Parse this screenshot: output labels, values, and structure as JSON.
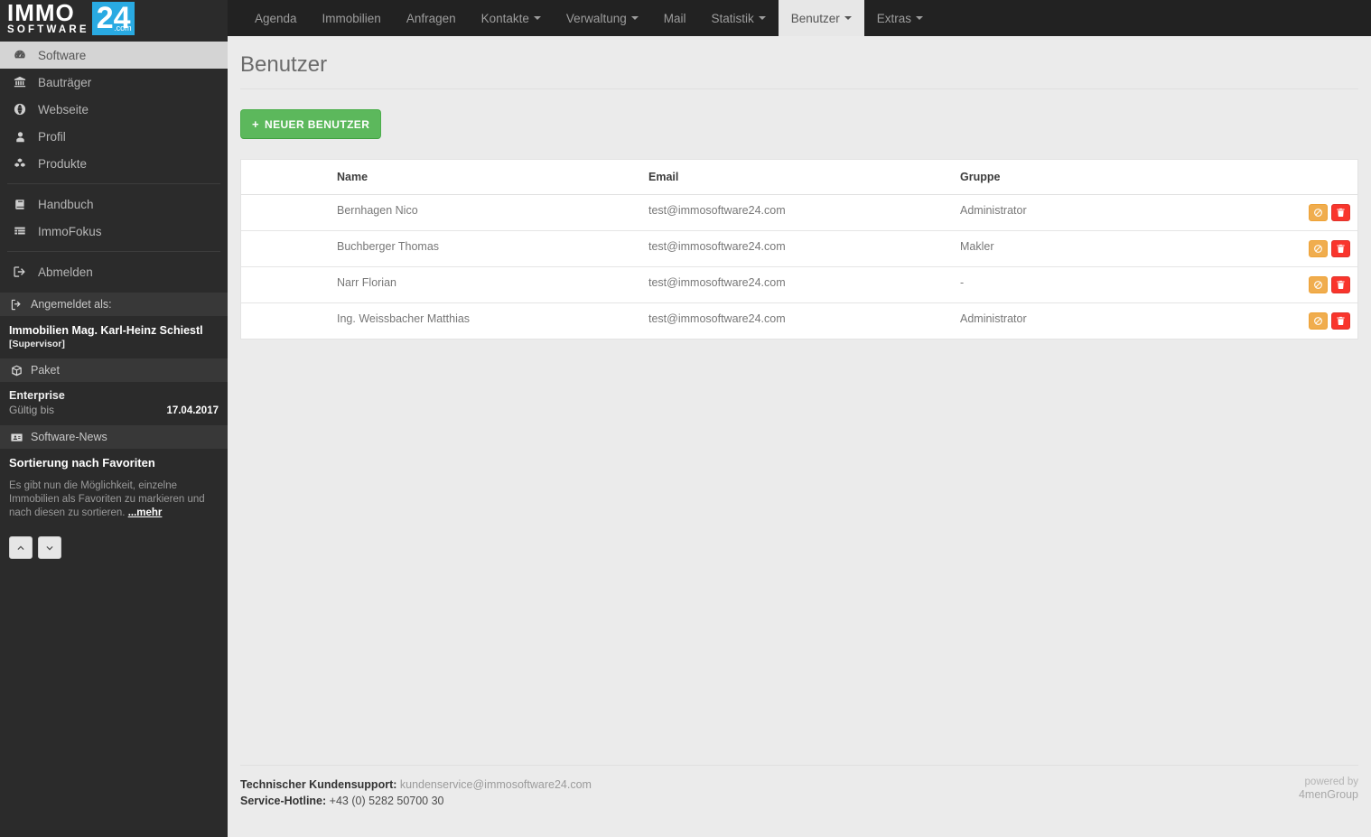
{
  "brand": {
    "immo": "IMMO",
    "software": "SOFTWARE",
    "twentyfour": "24",
    "com": ".com"
  },
  "topnav": {
    "items": [
      {
        "label": "Agenda",
        "caret": false,
        "active": false
      },
      {
        "label": "Immobilien",
        "caret": false,
        "active": false
      },
      {
        "label": "Anfragen",
        "caret": false,
        "active": false
      },
      {
        "label": "Kontakte",
        "caret": true,
        "active": false
      },
      {
        "label": "Verwaltung",
        "caret": true,
        "active": false
      },
      {
        "label": "Mail",
        "caret": false,
        "active": false
      },
      {
        "label": "Statistik",
        "caret": true,
        "active": false
      },
      {
        "label": "Benutzer",
        "caret": true,
        "active": true
      },
      {
        "label": "Extras",
        "caret": true,
        "active": false
      }
    ]
  },
  "sidebar": {
    "items": [
      {
        "label": "Software",
        "icon": "dashboard-icon",
        "active": true
      },
      {
        "label": "Bauträger",
        "icon": "bank-icon",
        "active": false
      },
      {
        "label": "Webseite",
        "icon": "globe-icon",
        "active": false
      },
      {
        "label": "Profil",
        "icon": "user-icon",
        "active": false
      },
      {
        "label": "Produkte",
        "icon": "cubes-icon",
        "active": false
      },
      {
        "label": "Handbuch",
        "icon": "book-icon",
        "active": false
      },
      {
        "label": "ImmoFokus",
        "icon": "table-list-icon",
        "active": false
      },
      {
        "label": "Abmelden",
        "icon": "sign-out-icon",
        "active": false
      }
    ],
    "logged_in": {
      "heading": "Angemeldet als:",
      "heading_icon": "sign-in-icon",
      "name": "Immobilien Mag. Karl-Heinz Schiestl",
      "role": "[Supervisor]"
    },
    "paket": {
      "heading": "Paket",
      "heading_icon": "cube-icon",
      "name": "Enterprise",
      "valid_label": "Gültig bis",
      "valid_date": "17.04.2017"
    },
    "news": {
      "heading": "Software-News",
      "heading_icon": "id-card-icon",
      "title": "Sortierung nach Favoriten",
      "body": "Es gibt nun die Möglichkeit, einzelne Immobilien als Favoriten zu markieren und nach diesen zu sortieren. ",
      "more": "...mehr",
      "prev_icon": "chevron-up-icon",
      "next_icon": "chevron-down-icon"
    }
  },
  "main": {
    "page_title": "Benutzer",
    "new_user_button": "NEUER BENUTZER",
    "new_user_plus": "+",
    "table": {
      "columns": [
        "",
        "Name",
        "Email",
        "Gruppe",
        ""
      ],
      "rows": [
        {
          "name": "Bernhagen Nico",
          "email": "test@immosoftware24.com",
          "gruppe": "Administrator",
          "actions": [
            "ban-icon",
            "trash-icon"
          ]
        },
        {
          "name": "Buchberger Thomas",
          "email": "test@immosoftware24.com",
          "gruppe": "Makler",
          "actions": [
            "ban-icon",
            "trash-icon"
          ]
        },
        {
          "name": "Narr Florian",
          "email": "test@immosoftware24.com",
          "gruppe": "-",
          "actions": [
            "ban-icon",
            "trash-icon"
          ]
        },
        {
          "name": "Ing. Weissbacher Matthias",
          "email": "test@immosoftware24.com",
          "gruppe": "Administrator",
          "actions": [
            "ban-icon",
            "trash-icon"
          ]
        }
      ]
    }
  },
  "footer": {
    "support_label": "Technischer Kundensupport:",
    "support_value": "kundenservice@immosoftware24.com",
    "hotline_label": "Service-Hotline:",
    "hotline_value": "+43 (0) 5282 50700 30",
    "powered_by": "powered by",
    "powered_brand": "4menGroup"
  },
  "colors": {
    "brand_blue": "#29aae2",
    "topbar": "#222222",
    "sidebar": "#2b2b2b",
    "accent_green": "#5cb85c",
    "action_orange": "#f0ad4e",
    "action_red": "#f9352c"
  }
}
